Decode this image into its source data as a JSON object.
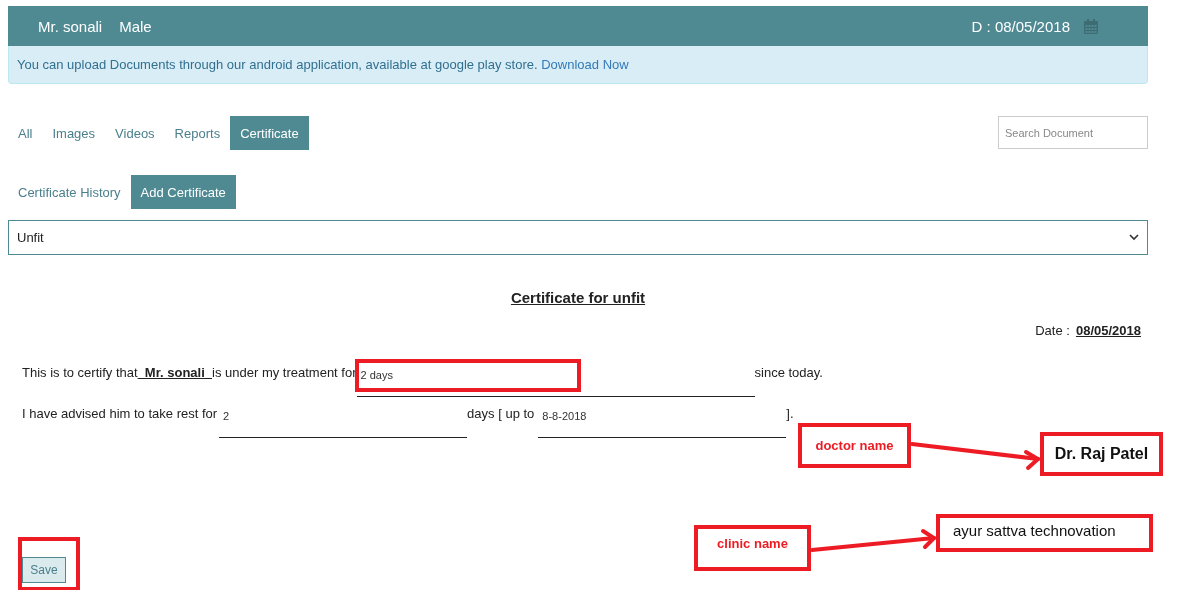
{
  "header": {
    "patient_name": "Mr. sonali",
    "gender": "Male",
    "date": "D : 08/05/2018"
  },
  "notice": {
    "text": "You can upload Documents through our android application, available at google play store.",
    "link": "Download Now"
  },
  "tabs": [
    {
      "label": "All",
      "selected": false
    },
    {
      "label": "Images",
      "selected": false
    },
    {
      "label": "Videos",
      "selected": false
    },
    {
      "label": "Reports",
      "selected": false
    },
    {
      "label": "Certificate",
      "selected": true
    }
  ],
  "search": {
    "placeholder": "Search Document"
  },
  "subtabs": [
    {
      "label": "Certificate History",
      "selected": false
    },
    {
      "label": "Add Certificate",
      "selected": true
    }
  ],
  "certificate_type": {
    "value": "Unfit"
  },
  "certificate": {
    "title": "Certificate for unfit",
    "date_label": "Date :",
    "date": "08/05/2018",
    "line_1": {
      "before": "This is to certify that",
      "patient": "Mr. sonali",
      "middle": "is under my treatment for",
      "duration": "2 days",
      "after": "since today."
    },
    "line_2": {
      "before": "I have advised him to take rest for",
      "rest_days": "2",
      "middle": "days [ up to",
      "until": "8-8-2018",
      "after": "]."
    },
    "doctor_name": "Dr. Raj Patel",
    "clinic_name": "ayur sattva technovation"
  },
  "save_button": "Save",
  "annotations": [
    {
      "label": "doctor name"
    },
    {
      "label": "clinic name"
    }
  ]
}
